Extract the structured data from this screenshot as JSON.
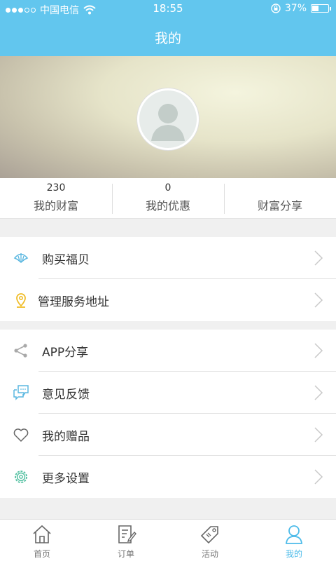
{
  "status_bar": {
    "carrier": "中国电信",
    "time": "18:55",
    "battery": "37%"
  },
  "header": {
    "title": "我的"
  },
  "stats": [
    {
      "value": "230",
      "label": "我的财富"
    },
    {
      "value": "0",
      "label": "我的优惠"
    },
    {
      "value": "",
      "label": "财富分享"
    }
  ],
  "menu_group_1": [
    {
      "label": "购买福贝",
      "icon": "shell-icon"
    },
    {
      "label": "管理服务地址",
      "icon": "location-pin-icon"
    }
  ],
  "menu_group_2": [
    {
      "label": "APP分享",
      "icon": "share-icon"
    },
    {
      "label": "意见反馈",
      "icon": "feedback-icon"
    },
    {
      "label": "我的赠品",
      "icon": "heart-icon"
    },
    {
      "label": "更多设置",
      "icon": "gear-icon"
    }
  ],
  "tabbar": [
    {
      "label": "首页",
      "icon": "home-icon"
    },
    {
      "label": "订单",
      "icon": "order-icon"
    },
    {
      "label": "活动",
      "icon": "tag-icon"
    },
    {
      "label": "我的",
      "icon": "user-icon"
    }
  ],
  "colors": {
    "accent": "#62c6ee",
    "active_tab": "#4dbbe9"
  }
}
